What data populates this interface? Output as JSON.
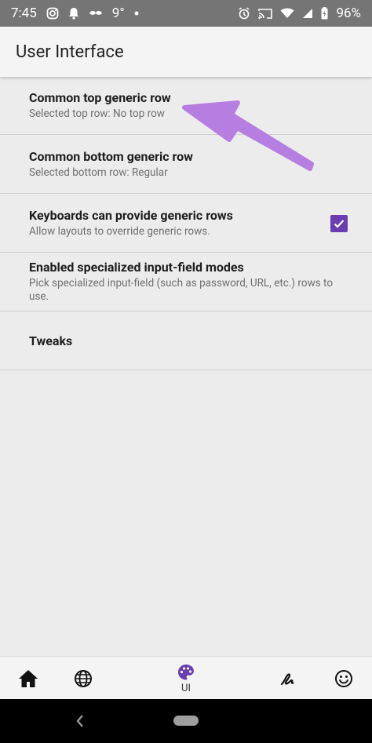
{
  "status_bar": {
    "time": "7:45",
    "temperature": "9°",
    "battery": "96%",
    "icons": [
      "instagram-icon",
      "notification-bell-icon",
      "mustache-icon",
      "dot-icon",
      "alarm-icon",
      "cast-icon",
      "wifi-icon",
      "signal-icon",
      "battery-icon"
    ]
  },
  "app_bar": {
    "title": "User Interface"
  },
  "settings": [
    {
      "title": "Common top generic row",
      "subtitle": "Selected top row: No top row"
    },
    {
      "title": "Common bottom generic row",
      "subtitle": "Selected bottom row: Regular"
    },
    {
      "title": "Keyboards can provide generic rows",
      "subtitle": "Allow layouts to override generic rows.",
      "checked": true
    },
    {
      "title": "Enabled specialized input-field modes",
      "subtitle": "Pick specialized input-field (such as password, URL, etc.) rows to use."
    },
    {
      "title": "Tweaks"
    }
  ],
  "bottom_nav": {
    "items": [
      {
        "icon": "home-icon"
      },
      {
        "icon": "globe-icon"
      },
      {
        "icon": "palette-icon",
        "label": "UI",
        "selected": true
      },
      {
        "icon": "gesture-icon"
      },
      {
        "icon": "smiley-icon"
      }
    ]
  },
  "colors": {
    "accent": "#6a3db0",
    "annotation_arrow": "#b57ee0"
  }
}
